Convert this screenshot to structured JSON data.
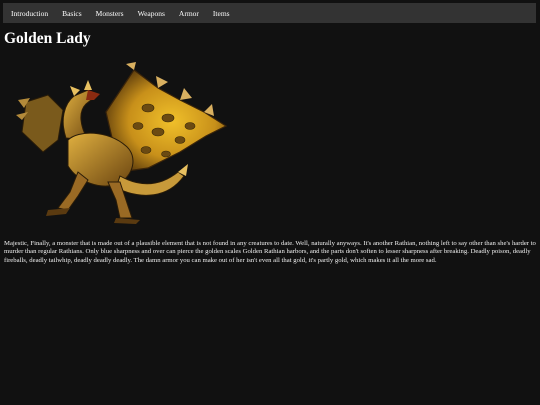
{
  "nav": {
    "items": [
      {
        "label": "Introduction"
      },
      {
        "label": "Basics"
      },
      {
        "label": "Monsters"
      },
      {
        "label": "Weapons"
      },
      {
        "label": "Armor"
      },
      {
        "label": "Items"
      }
    ]
  },
  "page": {
    "title": "Golden Lady",
    "description": "Majestic, Finally, a monster that is made out of a plausible element that is not found in any creatures to date. Well, naturally anyways. It's another Rathian, nothing left to say other than she's harder to murder than regular Rathians. Only blue sharpness and over can pierce the golden scales Golden Rathian harbors, and the parts don't soften to lesser sharpness after breaking. Deadly poison, deadly fireballs, deadly tailwhip, deadly deadly deadly. The damn armor you can make out of her isn't even all that gold, it's partly gold, which makes it all the more sad."
  },
  "image": {
    "icon": "gold-wyvern-illustration",
    "colors": {
      "gold": "#d8a21a",
      "dark": "#3a2a10",
      "spot": "#6b4a12"
    }
  }
}
